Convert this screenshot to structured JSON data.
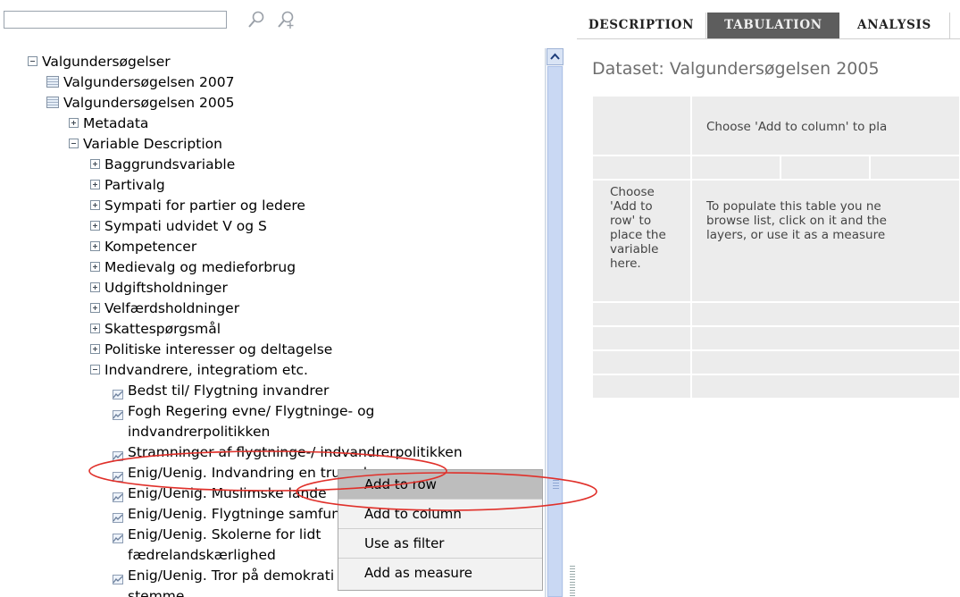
{
  "search": {
    "value": ""
  },
  "tree": {
    "root": "Valgundersøgelser",
    "datasets": [
      "Valgundersøgelsen 2007",
      "Valgundersøgelsen 2005"
    ],
    "metadata": "Metadata",
    "variable_description": "Variable Description",
    "groups": [
      "Baggrundsvariable",
      "Partivalg",
      "Sympati for partier og ledere",
      "Sympati udvidet V og S",
      "Kompetencer",
      "Medievalg og medieforbrug",
      "Udgiftsholdninger",
      "Velfærdsholdninger",
      "Skattespørgsmål",
      "Politiske interesser og deltagelse",
      "Indvandrere, integratiom etc."
    ],
    "variables": [
      {
        "line1": "Bedst til/ Flygtning invandrer"
      },
      {
        "line1": "Fogh Regering evne/ Flygtninge- og",
        "line2": "indvandrerpolitikken"
      },
      {
        "line1": "Stramninger af flygtninge-/ indvandrerpolitikken"
      },
      {
        "line1": "Enig/Uenig. Indvandring en trussel"
      },
      {
        "line1": "Enig/Uenig. Muslimske lande"
      },
      {
        "line1": "Enig/Uenig. Flygtninge samfund"
      },
      {
        "line1": "Enig/Uenig. Skolerne for lidt",
        "line2": "fædrelandskærlighed"
      },
      {
        "line1": "Enig/Uenig. Tror på demokrati",
        "line2": "stemme"
      }
    ]
  },
  "context_menu": {
    "items": [
      "Add to row",
      "Add to column",
      "Use as filter",
      "Add as measure"
    ],
    "active_index": 0
  },
  "tabs": [
    "DESCRIPTION",
    "TABULATION",
    "ANALYSIS"
  ],
  "active_tab": "TABULATION",
  "dataset_title": "Dataset: Valgundersøgelsen 2005",
  "table": {
    "column_prompt": "Choose 'Add to column' to pla",
    "row_prompt": [
      "Choose",
      "'Add to",
      "row' to",
      "place the",
      "variable",
      "here."
    ],
    "populate_text": [
      "To populate this table you ne",
      "browse list, click on it and the",
      "layers, or use it as a measure"
    ]
  },
  "colors": {
    "tab_active": "#5d5d5d",
    "annotation": "#e0302a",
    "grid_cell": "#ececec"
  },
  "icons": [
    "search-icon",
    "add-search-icon",
    "collapse-icon",
    "expand-icon",
    "dataset-icon",
    "variable-icon",
    "scroll-up-icon"
  ]
}
